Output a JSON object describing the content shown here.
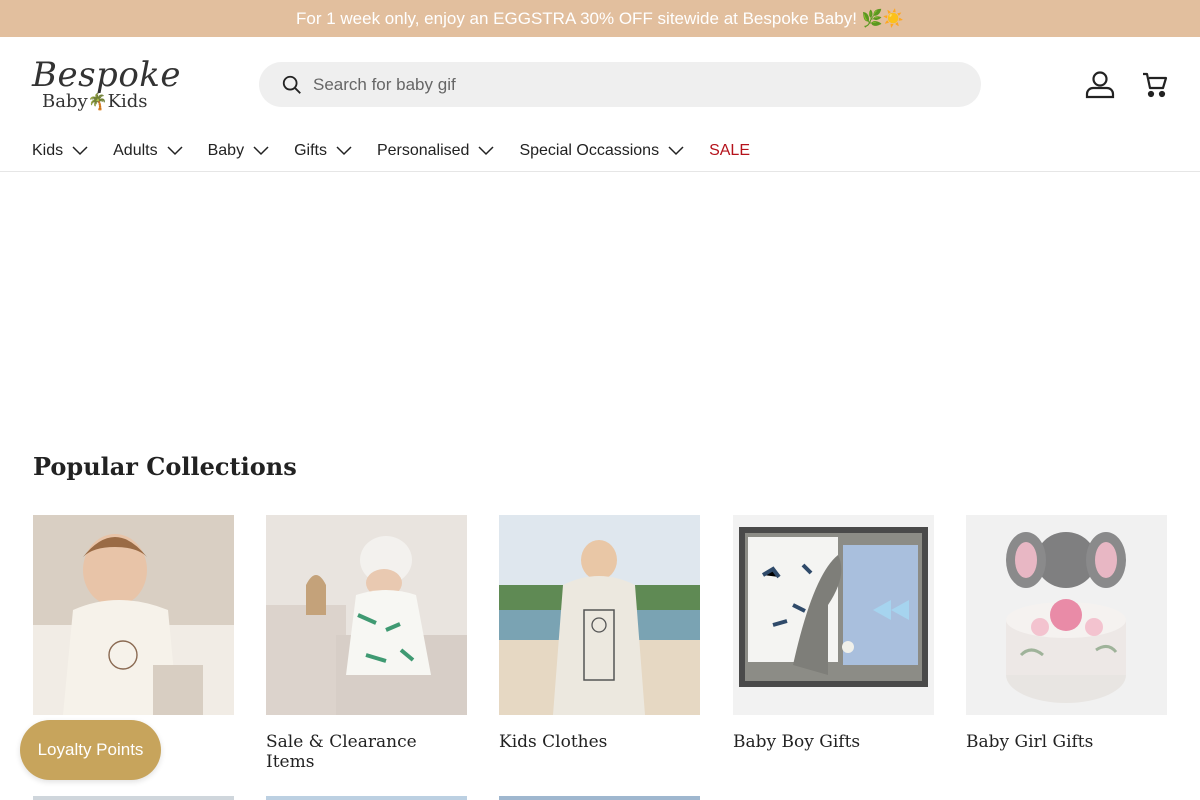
{
  "announcement": "For 1 week only, enjoy an EGGSTRA 30% OFF sitewide at Bespoke Baby! 🌿☀️",
  "logo": {
    "script": "Bespoke",
    "sub_left": "Baby",
    "sub_right": "Kids"
  },
  "search": {
    "placeholder": "Search for baby gif"
  },
  "icons": {
    "search": "search-icon",
    "account": "account-icon",
    "cart": "cart-icon",
    "chevron": "chevron-down-icon"
  },
  "nav": {
    "items": [
      {
        "label": "Kids"
      },
      {
        "label": "Adults"
      },
      {
        "label": "Baby"
      },
      {
        "label": "Gifts"
      },
      {
        "label": "Personalised"
      },
      {
        "label": "Special Occassions"
      }
    ],
    "sale": "SALE"
  },
  "section_title": "Popular Collections",
  "collections": [
    {
      "label": ""
    },
    {
      "label": "Sale & Clearance Items"
    },
    {
      "label": "Kids Clothes"
    },
    {
      "label": "Baby Boy Gifts"
    },
    {
      "label": "Baby Girl Gifts"
    }
  ],
  "loyalty_label": "Loyalty Points",
  "colors": {
    "announcement_bg": "#e2bf9e",
    "sale_red": "#b5121b",
    "loyalty_gold": "#c7a45c"
  }
}
